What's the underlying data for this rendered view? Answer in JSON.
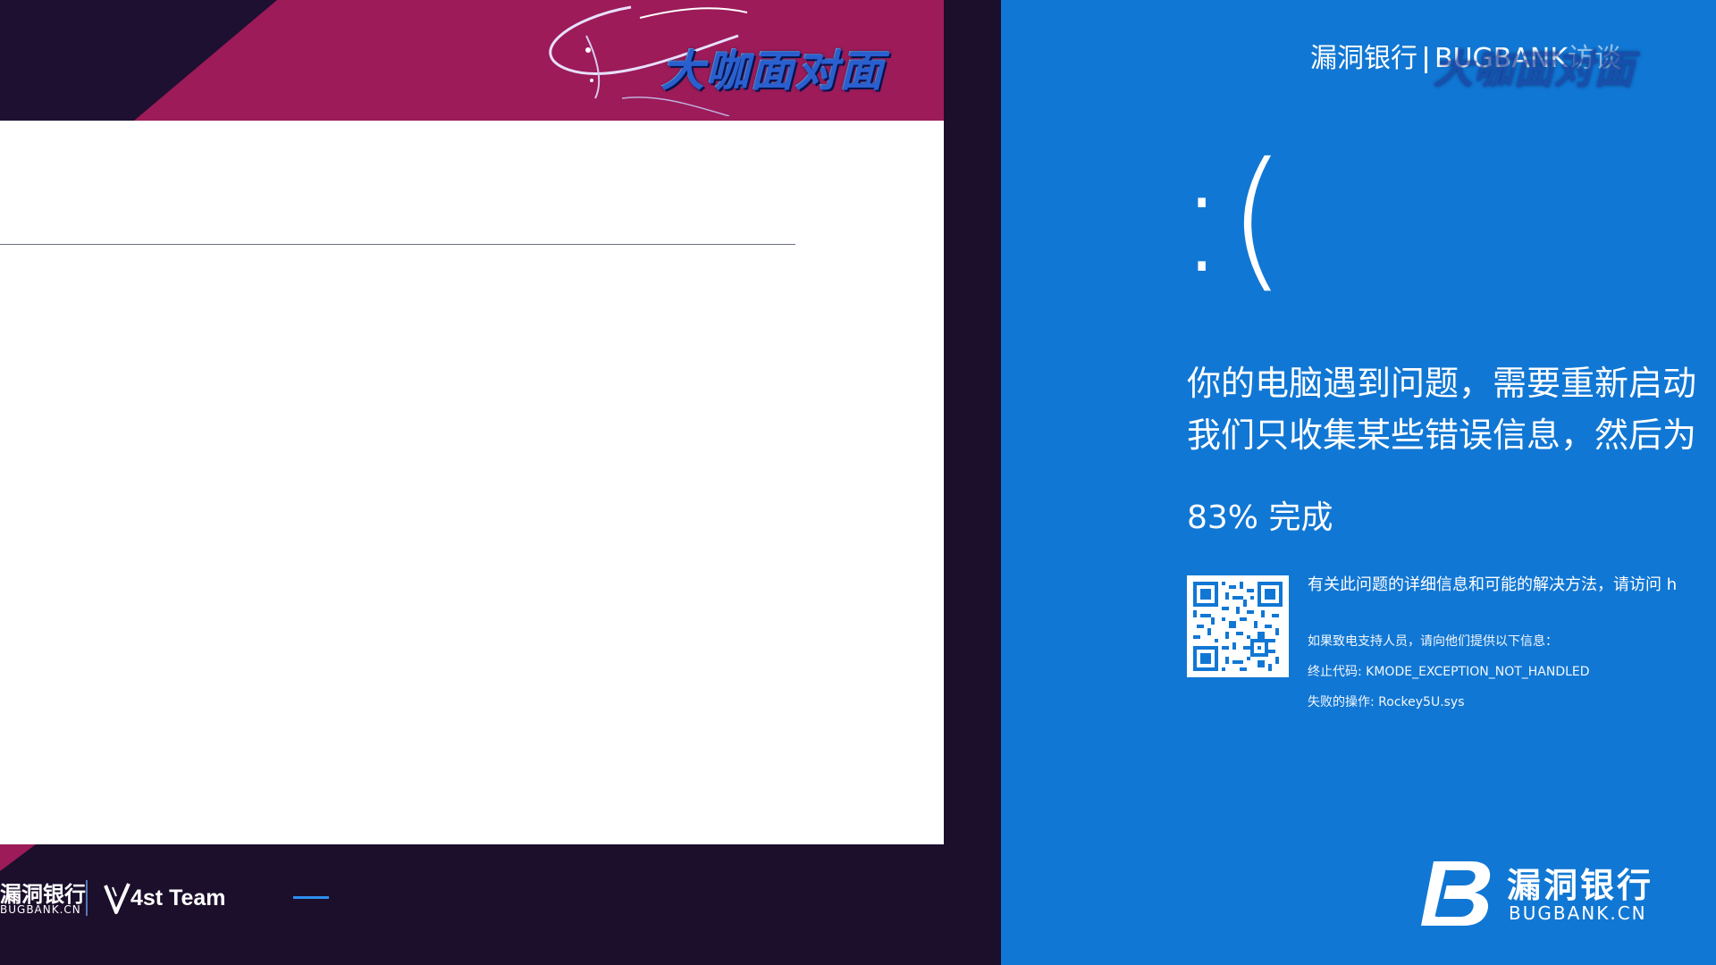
{
  "left_panel": {
    "show_logo": "大咖面对面",
    "footer": {
      "bugbank_cn": "漏洞银行",
      "bugbank_en": "BUGBANK.CN",
      "team": "4st Team"
    }
  },
  "bsod": {
    "watermark": {
      "left": "漏洞银行",
      "right": "BUGBANK",
      "suffix": "访谈",
      "overlay_logo": "大咖面对面"
    },
    "sad_face": ":(",
    "message_line1": "你的电脑遇到问题，需要重新启动",
    "message_line2": "我们只收集某些错误信息，然后为",
    "progress_percent": 83,
    "progress_text": "83% 完成",
    "info_text": "有关此问题的详细信息和可能的解决方法，请访问 h",
    "support_text": "如果致电支持人员，请向他们提供以下信息：",
    "stop_code": "终止代码: KMODE_EXCEPTION_NOT_HANDLED",
    "failed_operation": "失败的操作: Rockey5U.sys",
    "logo": {
      "cn": "漏洞银行",
      "en": "BUGBANK.CN"
    }
  },
  "colors": {
    "bsod_blue": "#1177d4",
    "banner_magenta": "#9c1b58",
    "background_dark": "#1b0f2c",
    "slide_white": "#ffffff"
  }
}
